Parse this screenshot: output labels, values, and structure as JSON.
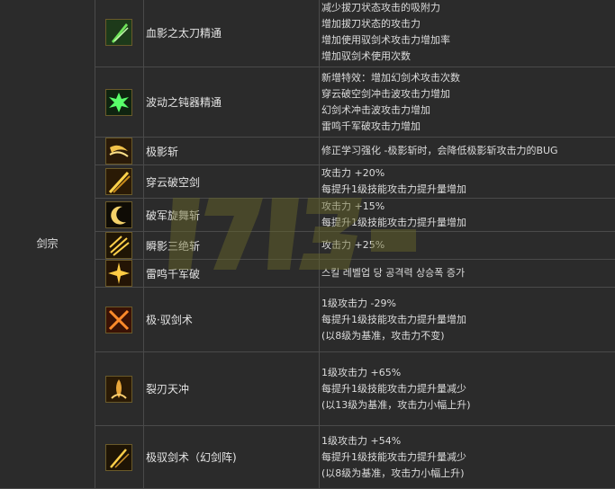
{
  "class_name": "剑宗",
  "skills": [
    {
      "name": "血影之太刀精通",
      "icon": "green-blade-icon",
      "desc": [
        "减少拔刀状态攻击的吸附力",
        "增加拔刀状态的攻击力",
        "增加使用驭剑术攻击力增加率",
        "增加驭剑术使用次数"
      ]
    },
    {
      "name": "波动之钝器精通",
      "icon": "green-burst-icon",
      "desc": [
        "新增特效：增加幻剑术攻击次数",
        "穿云破空剑冲击波攻击力增加",
        "幻剑术冲击波攻击力增加",
        "雷鸣千军破攻击力增加"
      ]
    },
    {
      "name": "极影斩",
      "icon": "shadow-slash-icon",
      "desc": [
        "修正学习强化 -极影斩时，会降低极影斩攻击力的BUG"
      ]
    },
    {
      "name": "穿云破空剑",
      "icon": "piercing-sword-icon",
      "desc": [
        "攻击力 +20%",
        "每提升1级技能攻击力提升量增加"
      ]
    },
    {
      "name": "破军旋舞斩",
      "icon": "crescent-spin-icon",
      "desc": [
        "攻击力 +15%",
        "每提升1级技能攻击力提升量增加"
      ]
    },
    {
      "name": "瞬影三绝斩",
      "icon": "triple-slash-icon",
      "desc": [
        "攻击力 +25%"
      ]
    },
    {
      "name": "雷鸣千军破",
      "icon": "thunder-burst-icon",
      "desc": [
        "스킬 레벨업 당 공격력 상승폭 증가"
      ]
    },
    {
      "name": "极·驭剑术",
      "icon": "crossed-swords-icon",
      "desc": [
        "1级攻击力 -29%",
        "每提升1级技能攻击力提升量增加",
        "(以8级为基准，攻击力不变)"
      ]
    },
    {
      "name": "裂刃天冲",
      "icon": "rising-blade-icon",
      "desc": [
        "1级攻击力 +65%",
        "每提升1级技能攻击力提升量减少",
        "(以13级为基准，攻击力小幅上升)"
      ]
    },
    {
      "name": "极驭剑术（幻剑阵)",
      "icon": "phantom-sword-icon",
      "desc": [
        "1级攻击力 +54%",
        "每提升1级技能攻击力提升量减少",
        "(以8级为基准，攻击力小幅上升)"
      ]
    }
  ]
}
